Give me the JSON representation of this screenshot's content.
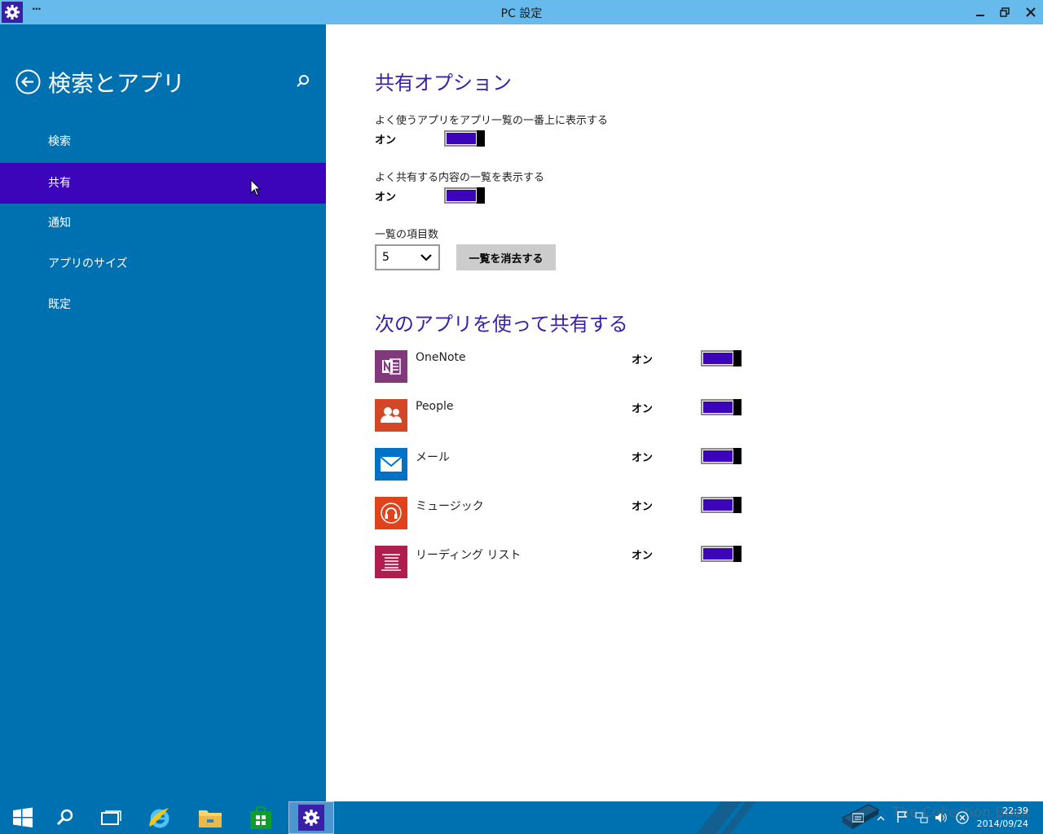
{
  "window": {
    "title": "PC 設定",
    "menu_label": "···",
    "controls": [
      "minimize",
      "restore",
      "close"
    ]
  },
  "sidebar": {
    "heading": "検索とアプリ",
    "items": [
      {
        "label": "検索",
        "selected": false
      },
      {
        "label": "共有",
        "selected": true
      },
      {
        "label": "通知",
        "selected": false
      },
      {
        "label": "アプリのサイズ",
        "selected": false
      },
      {
        "label": "既定",
        "selected": false
      }
    ]
  },
  "share_options": {
    "title": "共有オプション",
    "frequent_apps": {
      "label": "よく使うアプリをアプリ一覧の一番上に表示する",
      "state": "オン"
    },
    "frequent_content": {
      "label": "よく共有する内容の一覧を表示する",
      "state": "オン"
    },
    "list_count": {
      "label": "一覧の項目数",
      "value": "5"
    },
    "clear_button": "一覧を消去する"
  },
  "share_apps": {
    "title": "次のアプリを使って共有する",
    "items": [
      {
        "name": "OneNote",
        "state": "オン",
        "color": "#80397b",
        "icon": "onenote-icon"
      },
      {
        "name": "People",
        "state": "オン",
        "color": "#d24726",
        "icon": "people-icon"
      },
      {
        "name": "メール",
        "state": "オン",
        "color": "#0072c6",
        "icon": "mail-icon"
      },
      {
        "name": "ミュージック",
        "state": "オン",
        "color": "#e0421c",
        "icon": "headphones-icon"
      },
      {
        "name": "リーディング リスト",
        "state": "オン",
        "color": "#b01e4f",
        "icon": "reading-list-icon"
      }
    ]
  },
  "taskbar": {
    "time": "22:39",
    "date": "2014/09/24",
    "watermark": "The Collection Book"
  },
  "colors": {
    "accent": "#3d05b9",
    "sidebar": "#0071b0",
    "titlebar": "#67bbec"
  }
}
